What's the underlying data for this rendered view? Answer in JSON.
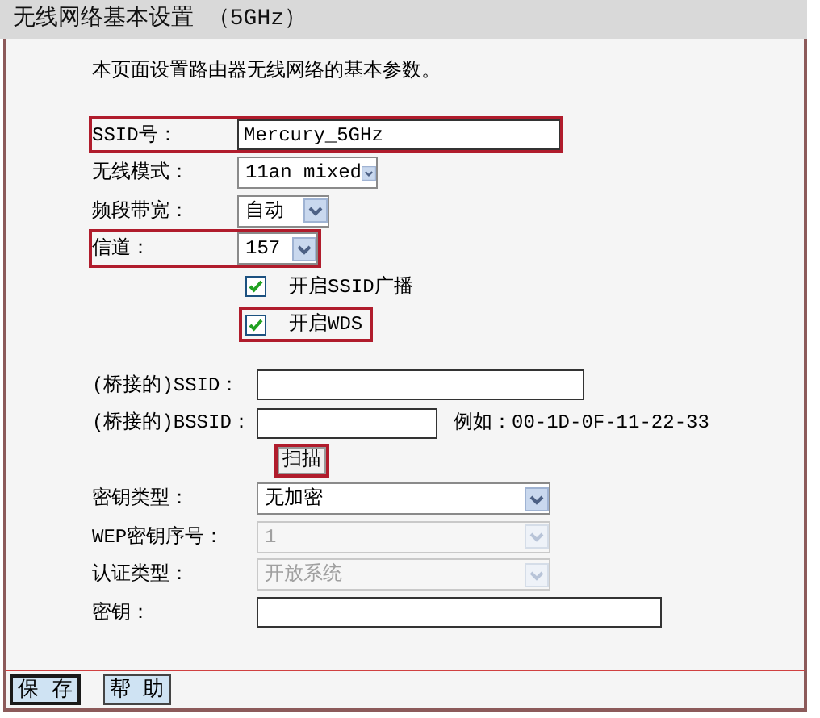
{
  "title": "无线网络基本设置 （5GHz）",
  "description": "本页面设置路由器无线网络的基本参数。",
  "sections": [
    {
      "rows": [
        {
          "kind": "text",
          "label": "SSID号：",
          "value": "Mercury_5GHz",
          "highlighted": true
        },
        {
          "kind": "select",
          "label": "无线模式：",
          "value": "11an mixed",
          "highlighted": false,
          "disabled": false
        },
        {
          "kind": "select",
          "label": "频段带宽：",
          "value": "自动",
          "highlighted": false,
          "disabled": false
        },
        {
          "kind": "select",
          "label": "信道：",
          "value": "157",
          "highlighted": true,
          "disabled": false
        },
        {
          "kind": "checkbox",
          "label": "开启SSID广播",
          "checked": true,
          "highlighted": false
        },
        {
          "kind": "checkbox",
          "label": "开启WDS",
          "checked": true,
          "highlighted": true
        }
      ]
    },
    {
      "rows": [
        {
          "kind": "text",
          "label": "(桥接的)SSID：",
          "highlighted": false
        },
        {
          "kind": "text",
          "label": "(桥接的)BSSID：",
          "hint": "例如：00-1D-0F-11-22-33",
          "highlighted": false
        },
        {
          "kind": "button",
          "label": "扫描",
          "highlighted": true
        },
        {
          "kind": "select",
          "label": "密钥类型：",
          "value": "无加密",
          "highlighted": false,
          "disabled": false
        },
        {
          "kind": "select",
          "label": "WEP密钥序号：",
          "value": "1",
          "highlighted": false,
          "disabled": true
        },
        {
          "kind": "select",
          "label": "认证类型：",
          "value": "开放系统",
          "highlighted": false,
          "disabled": true
        },
        {
          "kind": "text",
          "label": "密钥：",
          "highlighted": false
        }
      ]
    }
  ],
  "buttons": [
    {
      "label": "保 存",
      "focused": true
    },
    {
      "label": "帮 助",
      "focused": false
    }
  ]
}
